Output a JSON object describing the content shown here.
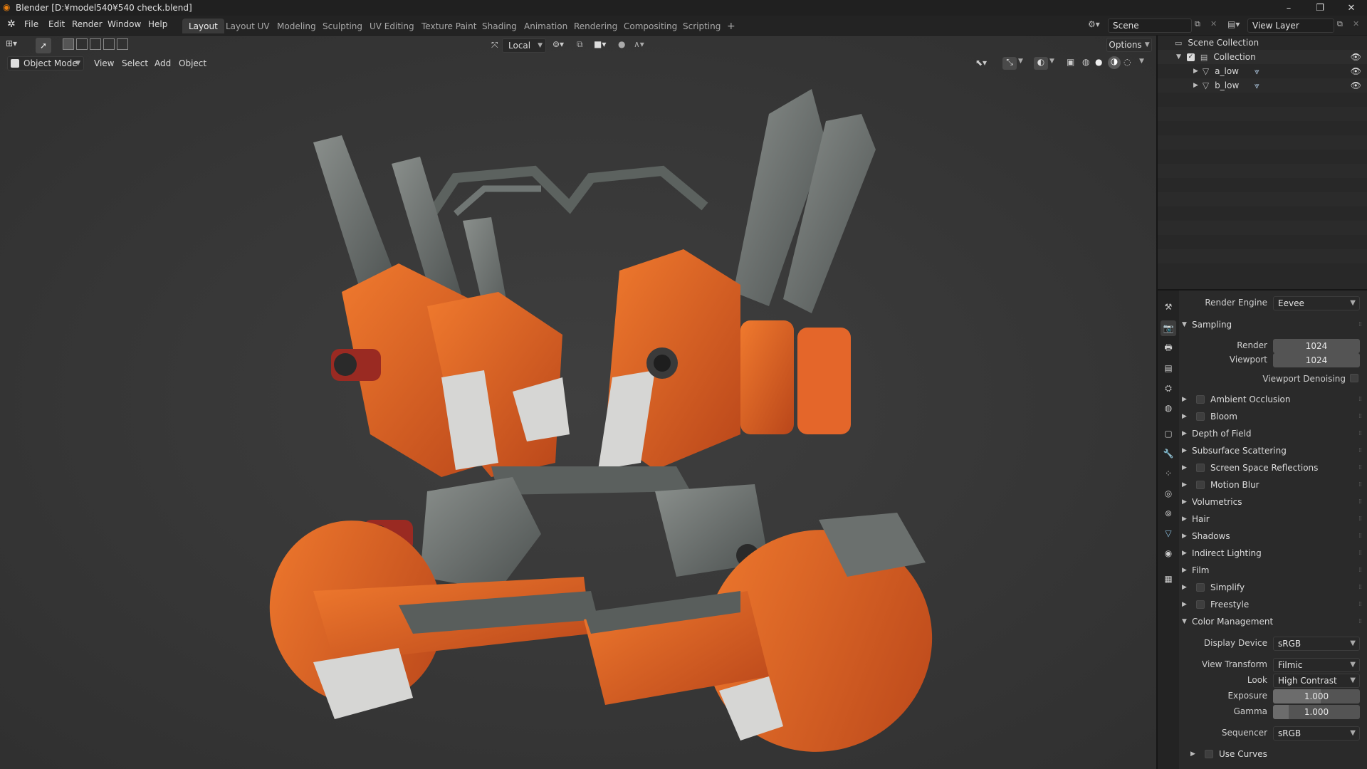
{
  "window": {
    "title": "Blender [D:¥model540¥540 check.blend]",
    "minimize": "–",
    "maximize": "❐",
    "close": "✕"
  },
  "menu": [
    "File",
    "Edit",
    "Render",
    "Window",
    "Help"
  ],
  "workspaces": {
    "tabs": [
      "Layout",
      "Layout UV",
      "Modeling",
      "Sculpting",
      "UV Editing",
      "Texture Paint",
      "Shading",
      "Animation",
      "Rendering",
      "Compositing",
      "Scripting"
    ],
    "active": "Layout",
    "add": "+"
  },
  "scene": {
    "name": "Scene",
    "view_layer": "View Layer"
  },
  "viewport_header": {
    "transform_orientation": "Local",
    "options_label": "Options",
    "mode": "Object Mode",
    "menus": [
      "View",
      "Select",
      "Add",
      "Object"
    ]
  },
  "outliner": {
    "root": "Scene Collection",
    "collection": "Collection",
    "objects": [
      "a_low",
      "b_low"
    ]
  },
  "properties": {
    "render_engine_label": "Render Engine",
    "render_engine": "Eevee",
    "sampling": {
      "title": "Sampling",
      "render_label": "Render",
      "render": "1024",
      "viewport_label": "Viewport",
      "viewport": "1024",
      "denoise_label": "Viewport Denoising"
    },
    "panels": [
      {
        "label": "Ambient Occlusion",
        "checkbox": true
      },
      {
        "label": "Bloom",
        "checkbox": true
      },
      {
        "label": "Depth of Field",
        "checkbox": false
      },
      {
        "label": "Subsurface Scattering",
        "checkbox": false
      },
      {
        "label": "Screen Space Reflections",
        "checkbox": true
      },
      {
        "label": "Motion Blur",
        "checkbox": true
      },
      {
        "label": "Volumetrics",
        "checkbox": false
      },
      {
        "label": "Hair",
        "checkbox": false
      },
      {
        "label": "Shadows",
        "checkbox": false
      },
      {
        "label": "Indirect Lighting",
        "checkbox": false
      },
      {
        "label": "Film",
        "checkbox": false
      },
      {
        "label": "Simplify",
        "checkbox": true
      },
      {
        "label": "Freestyle",
        "checkbox": true
      }
    ],
    "color_management": {
      "title": "Color Management",
      "display_device_label": "Display Device",
      "display_device": "sRGB",
      "view_transform_label": "View Transform",
      "view_transform": "Filmic",
      "look_label": "Look",
      "look": "High Contrast",
      "exposure_label": "Exposure",
      "exposure": "1.000",
      "gamma_label": "Gamma",
      "gamma": "1.000",
      "sequencer_label": "Sequencer",
      "sequencer": "sRGB",
      "use_curves_label": "Use Curves"
    }
  },
  "colors": {
    "accent_orange": "#e3631f",
    "active_tab": "#3a3a3a",
    "metal": "#6b6f6d"
  }
}
